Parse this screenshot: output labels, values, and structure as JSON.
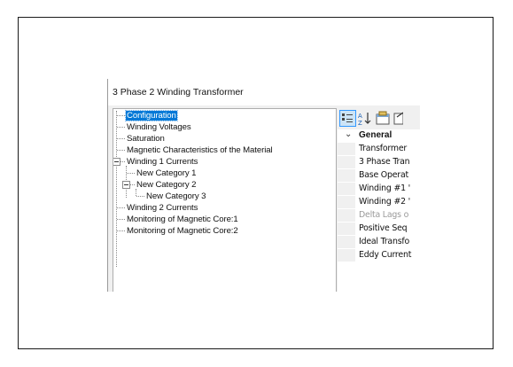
{
  "window": {
    "title": "3 Phase 2 Winding Transformer"
  },
  "tree": {
    "items": [
      {
        "label": "Configuration",
        "selected": true
      },
      {
        "label": "Winding Voltages"
      },
      {
        "label": "Saturation"
      },
      {
        "label": "Magnetic Characteristics of the Material"
      },
      {
        "label": "Winding 1 Currents",
        "expanded": true
      },
      {
        "label": "New Category 1"
      },
      {
        "label": "New Category 2",
        "expanded": true
      },
      {
        "label": "New Category 3"
      },
      {
        "label": "Winding 2 Currents"
      },
      {
        "label": "Monitoring of Magnetic Core:1"
      },
      {
        "label": "Monitoring of Magnetic Core:2"
      }
    ]
  },
  "toolbar": {
    "buttons": [
      {
        "icon": "categorized-icon",
        "active": true
      },
      {
        "icon": "alphabetical-sort-icon"
      },
      {
        "icon": "property-pages-icon"
      },
      {
        "icon": "edit-page-icon"
      }
    ]
  },
  "property_grid": {
    "category": "General",
    "properties": [
      {
        "name": "Transformer"
      },
      {
        "name": "3 Phase Tran"
      },
      {
        "name": "Base Operat"
      },
      {
        "name": "Winding #1 '"
      },
      {
        "name": "Winding #2 '"
      },
      {
        "name": "Delta Lags o",
        "disabled": true
      },
      {
        "name": "Positive Seq"
      },
      {
        "name": "Ideal Transfo"
      },
      {
        "name": "Eddy Current"
      }
    ]
  },
  "colors": {
    "selection": "#0078d7",
    "toolbar_active": "#cce4f7"
  }
}
